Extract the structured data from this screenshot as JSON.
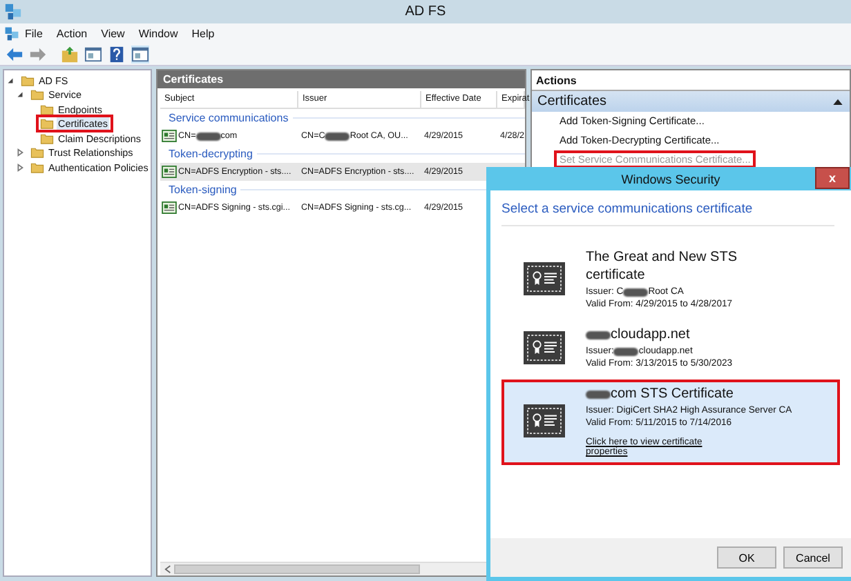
{
  "window": {
    "title": "AD FS"
  },
  "menu": [
    "File",
    "Action",
    "View",
    "Window",
    "Help"
  ],
  "toolbar": [
    {
      "kind": "back",
      "disabled": false
    },
    {
      "kind": "forward",
      "disabled": true
    },
    {
      "kind": "up"
    },
    {
      "kind": "tree"
    },
    {
      "kind": "help"
    },
    {
      "kind": "pane"
    }
  ],
  "tree": [
    {
      "label": "AD FS",
      "expanded": true,
      "selected": false,
      "highlighted": false,
      "children": [
        {
          "label": "Service",
          "expanded": true,
          "selected": false,
          "highlighted": false,
          "children": [
            {
              "label": "Endpoints",
              "selected": false,
              "highlighted": false
            },
            {
              "label": "Certificates",
              "selected": true,
              "highlighted": true
            },
            {
              "label": "Claim Descriptions",
              "selected": false,
              "highlighted": false
            }
          ]
        },
        {
          "label": "Trust Relationships",
          "expanded": false,
          "selected": false,
          "highlighted": false,
          "collapsible": true
        },
        {
          "label": "Authentication Policies",
          "expanded": false,
          "selected": false,
          "highlighted": false,
          "collapsible": true
        }
      ]
    }
  ],
  "center": {
    "title": "Certificates",
    "columns": [
      "Subject",
      "Issuer",
      "Effective Date",
      "Expirat"
    ],
    "groups": [
      {
        "label": "Service communications",
        "rows": [
          {
            "selected": false,
            "cells": [
              [
                {
                  "kind": "text",
                  "text": "CN="
                },
                {
                  "kind": "redacted"
                },
                {
                  "kind": "text",
                  "text": "com"
                }
              ],
              [
                {
                  "kind": "text",
                  "text": "CN=C"
                },
                {
                  "kind": "redacted"
                },
                {
                  "kind": "text",
                  "text": "Root CA, OU..."
                }
              ],
              [
                {
                  "kind": "text",
                  "text": "4/29/2015"
                }
              ],
              [
                {
                  "kind": "text",
                  "text": "4/28/2"
                }
              ]
            ]
          }
        ]
      },
      {
        "label": "Token-decrypting",
        "rows": [
          {
            "selected": true,
            "cells": [
              [
                {
                  "kind": "text",
                  "text": "CN=ADFS Encryption - sts...."
                }
              ],
              [
                {
                  "kind": "text",
                  "text": "CN=ADFS Encryption - sts...."
                }
              ],
              [
                {
                  "kind": "text",
                  "text": "4/29/2015"
                }
              ]
            ]
          }
        ]
      },
      {
        "label": "Token-signing",
        "rows": [
          {
            "selected": false,
            "cells": [
              [
                {
                  "kind": "text",
                  "text": "CN=ADFS Signing - sts.cgi..."
                }
              ],
              [
                {
                  "kind": "text",
                  "text": "CN=ADFS Signing - sts.cg..."
                }
              ],
              [
                {
                  "kind": "text",
                  "text": "4/29/2015"
                }
              ]
            ]
          }
        ]
      }
    ]
  },
  "actions": {
    "title": "Actions",
    "section": "Certificates",
    "items": [
      {
        "label": "Add Token-Signing Certificate...",
        "disabled": false,
        "highlighted": false
      },
      {
        "label": "Add Token-Decrypting Certificate...",
        "disabled": false,
        "highlighted": false
      },
      {
        "label": "Set Service Communications Certificate...",
        "disabled": true,
        "highlighted": true
      }
    ]
  },
  "dialog": {
    "title": "Windows Security",
    "close": "x",
    "heading": "Select a service communications certificate",
    "certificates": [
      {
        "selected": false,
        "highlighted": false,
        "title": [
          {
            "kind": "text",
            "text": "The Great and New STS certificate"
          }
        ],
        "issuer": [
          {
            "kind": "text",
            "text": "Issuer: C"
          },
          {
            "kind": "redacted"
          },
          {
            "kind": "text",
            "text": "Root CA"
          }
        ],
        "valid": "Valid From: 4/29/2015 to 4/28/2017"
      },
      {
        "selected": false,
        "highlighted": false,
        "title": [
          {
            "kind": "redacted"
          },
          {
            "kind": "text",
            "text": "cloudapp.net"
          }
        ],
        "issuer": [
          {
            "kind": "text",
            "text": "Issuer: "
          },
          {
            "kind": "redacted"
          },
          {
            "kind": "text",
            "text": "cloudapp.net"
          }
        ],
        "valid": "Valid From: 3/13/2015 to 5/30/2023"
      },
      {
        "selected": true,
        "highlighted": true,
        "title": [
          {
            "kind": "redacted"
          },
          {
            "kind": "text",
            "text": "com STS Certificate"
          }
        ],
        "issuer": [
          {
            "kind": "text",
            "text": "Issuer: DigiCert SHA2 High Assurance Server CA"
          }
        ],
        "valid": "Valid From: 5/11/2015 to 7/14/2016",
        "link": "Click here to view certificate properties"
      }
    ],
    "buttons": [
      "OK",
      "Cancel"
    ]
  }
}
